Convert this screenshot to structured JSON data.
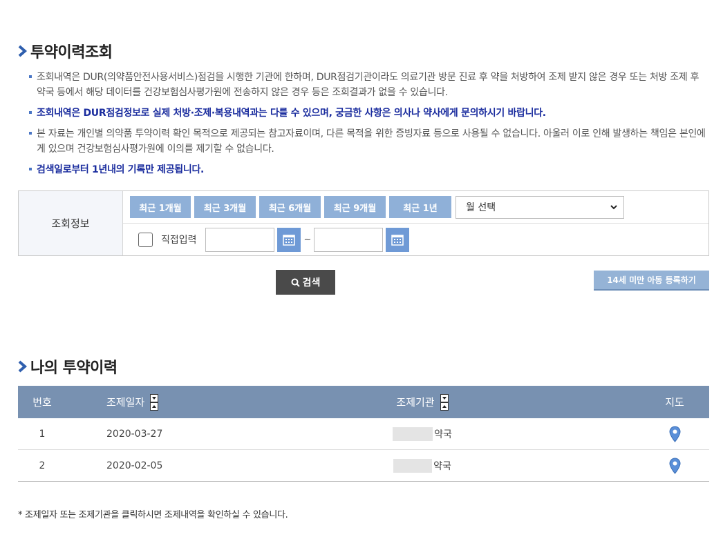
{
  "section1": {
    "title": "투약이력조회"
  },
  "notes": [
    "조회내역은 DUR(의약품안전사용서비스)점검을 시행한 기관에 한하며, DUR점검기관이라도 의료기관 방문 진료 후 약을 처방하여 조제 받지 않은 경우 또는 처방 조제 후 약국 등에서 해당 데이터를 건강보험심사평가원에 전송하지 않은 경우 등은 조회결과가 없을 수 있습니다.",
    "조회내역은 DUR점검정보로 실제 처방·조제·복용내역과는 다를 수 있으며, 궁금한 사항은 의사나 약사에게 문의하시기 바랍니다.",
    "본 자료는 개인별 의약품 투약이력 확인 목적으로 제공되는 참고자료이며, 다른 목적을 위한 증빙자료 등으로 사용될 수 없습니다. 아울러 이로 인해 발생하는 책임은 본인에게 있으며 건강보험심사평가원에 이의를 제기할 수 없습니다.",
    "검색일로부터 1년내의 기록만 제공됩니다."
  ],
  "search": {
    "label": "조회정보",
    "periods": [
      "최근 1개월",
      "최근 3개월",
      "최근 6개월",
      "최근 9개월",
      "최근 1년"
    ],
    "month_select": "월 선택",
    "direct_input_label": "직접입력",
    "tilde": "~",
    "search_button": "검색",
    "child_button": "14세 미만 아동 등록하기"
  },
  "section2": {
    "title": "나의 투약이력"
  },
  "table": {
    "headers": {
      "no": "번호",
      "date": "조제일자",
      "institution": "조제기관",
      "map": "지도"
    },
    "rows": [
      {
        "no": "1",
        "date": "2020-03-27",
        "institution": "약국"
      },
      {
        "no": "2",
        "date": "2020-02-05",
        "institution": "약국"
      }
    ]
  },
  "footnote": "* 조제일자 또는 조제기관을 클릭하시면 조제내역을 확인하실 수 있습니다.",
  "colors": {
    "accent": "#7891b1",
    "period_button": "#8fb0d8",
    "notice_blue": "#1a2c9e"
  }
}
